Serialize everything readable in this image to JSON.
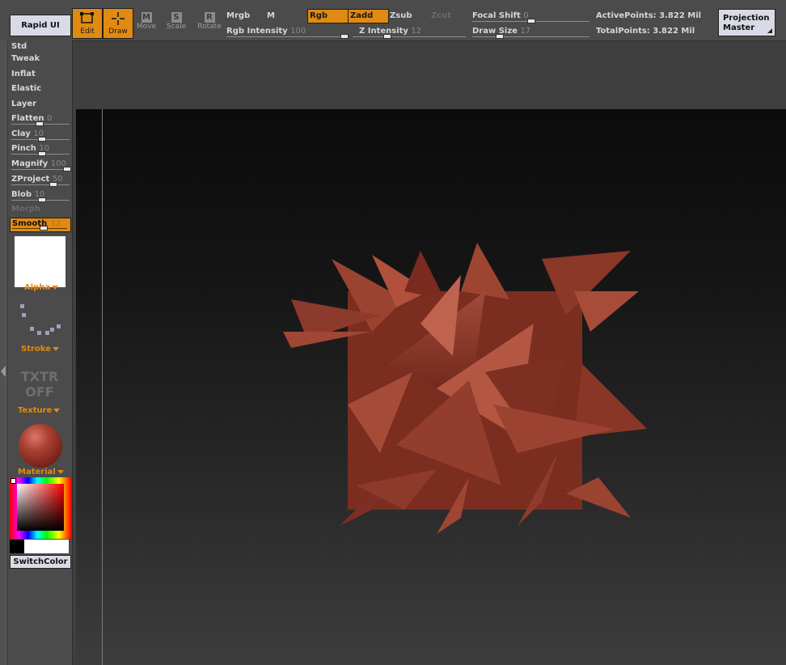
{
  "toolbar": {
    "rapid_ui": "Rapid UI",
    "edit": "Edit",
    "draw": "Draw",
    "move": "Move",
    "scale": "Scale",
    "rotate": "Rotate",
    "move_glyph": "M",
    "scale_glyph": "S",
    "rotate_glyph": "R",
    "mrgb": "Mrgb",
    "m": "M",
    "rgb": "Rgb",
    "zadd": "Zadd",
    "zsub": "Zsub",
    "zcut": "Zcut",
    "rgb_intensity_label": "Rgb Intensity",
    "rgb_intensity_value": "100",
    "z_intensity_label": "Z Intensity",
    "z_intensity_value": "12",
    "focal_shift_label": "Focal Shift",
    "focal_shift_value": "0",
    "draw_size_label": "Draw Size",
    "draw_size_value": "17",
    "active_points_label": "ActivePoints:",
    "active_points_value": "3.822",
    "active_points_unit": "Mil",
    "total_points_label": "TotalPoints:",
    "total_points_value": "3.822",
    "total_points_unit": "Mil",
    "projection_line1": "Projection",
    "projection_line2": "Master"
  },
  "left_shelf": {
    "brushes": [
      {
        "label": "Std"
      },
      {
        "label": "Tweak"
      },
      {
        "label": "Inflat"
      },
      {
        "label": "Elastic"
      },
      {
        "label": "Layer"
      }
    ],
    "slider_brushes": [
      {
        "label": "Flatten",
        "value": "0"
      },
      {
        "label": "Clay",
        "value": "10"
      },
      {
        "label": "Pinch",
        "value": "10"
      },
      {
        "label": "Magnify",
        "value": "100"
      },
      {
        "label": "ZProject",
        "value": "50"
      },
      {
        "label": "Blob",
        "value": "10"
      }
    ],
    "morph": "Morph",
    "smooth_label": "Smooth",
    "smooth_value": "12",
    "alpha": "Alpha",
    "stroke": "Stroke",
    "txtr_line1": "TXTR",
    "txtr_line2": "OFF",
    "texture": "Texture",
    "material": "Material",
    "switch_color": "SwitchColor"
  },
  "colors": {
    "accent_orange": "#e08a12",
    "panel_grey": "#4b4b4b",
    "mesh_red": "#8c3a2c"
  }
}
